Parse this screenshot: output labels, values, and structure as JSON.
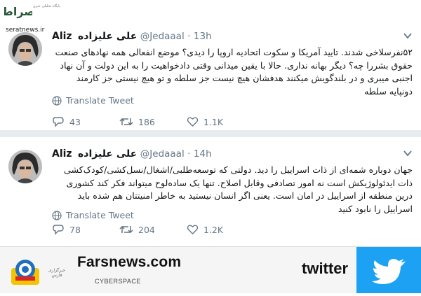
{
  "watermark": {
    "logo_text": "صراط",
    "small_text": "پایگاه تحلیلی خبری",
    "url": "seratnews.ir"
  },
  "tweets": [
    {
      "name": "Aliz",
      "name_fa": "علی علیزاده",
      "handle": "@Jedaaal",
      "dot": "·",
      "time": "13h",
      "body": "۵۲نفرسلاخی شدند. تایید آمریکا و سکوت اتحادیه اروپا را دیدی؟ موضع انفعالی همه نهادهای صنعت حقوق بشررا چه؟ دیگر بهانه نداری. حالا با یقین میدانی وقتی دادخواهیت را به این دولت و آن نهاد اجنبی میبری و در بلندگویش میکنند هدفشان هیچ نیست جز سلطه و تو هیچ نیستی جز کارمند دونپایه سلطه",
      "translate": "Translate Tweet",
      "replies": "43",
      "retweets": "186",
      "likes": "1.1K"
    },
    {
      "name": "Aliz",
      "name_fa": "علی علیزاده",
      "handle": "@Jedaaal",
      "dot": "·",
      "time": "14h",
      "body": "جهان دوباره شمه‌ای از ذات اسراییل را دید. دولتی که توسعه‌طلبی/اشغال/نسل‌کشی/کودک‌کشی ذات ایدئولوژیکش است نه امور تصادفی وقابل اصلاح. تنها یک ساده‌لوح میتواند فکر کند کشوری درین منطقه از اسراییل در امان است. یعنی اگر انسان نیستید به خاطر امنیتتان هم شده باید اسراییل را نابود کنید",
      "translate": "Translate Tweet",
      "replies": "78",
      "retweets": "204",
      "likes": "1.2K"
    }
  ],
  "footer": {
    "agency_text": "خبرگزاری فارس",
    "site": "Farsnews.com",
    "section": "CYBERSPACE",
    "twitter_word": "twitter"
  },
  "colors": {
    "twitter_blue": "#1da1f2",
    "muted": "#657786",
    "separator": "#e6ecf0"
  },
  "icons": [
    "reply-icon",
    "retweet-icon",
    "heart-icon",
    "translate-globe-icon",
    "chevron-down-icon",
    "twitter-bird-icon",
    "farsnews-logo"
  ]
}
